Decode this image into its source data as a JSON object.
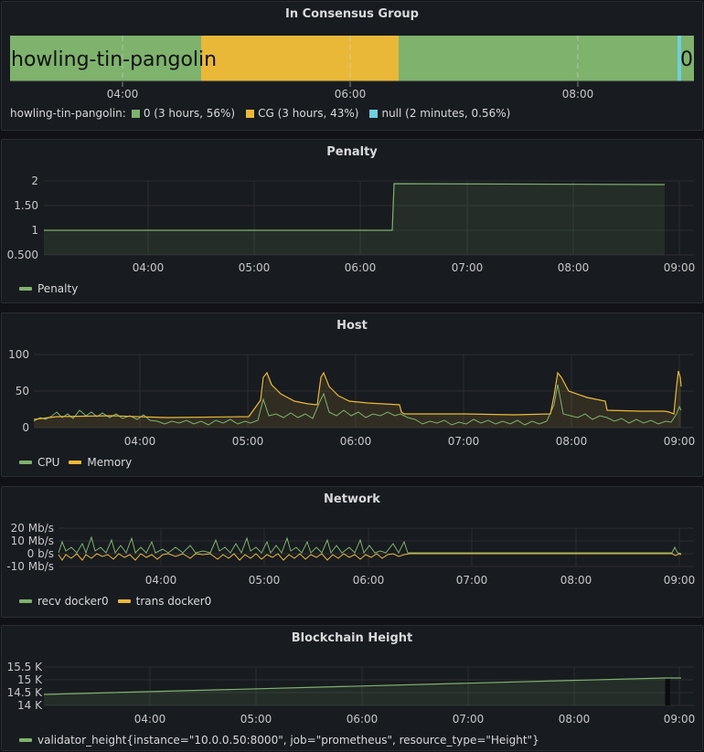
{
  "colors": {
    "green": "#7eb26d",
    "yellow": "#eab839",
    "cyan": "#6ed0e0",
    "grid": "#2b2e33",
    "bg": "#181b1f"
  },
  "consensus": {
    "title": "In Consensus Group",
    "left_label": "howling-tin-pangolin",
    "right_label": "0",
    "times": [
      "04:00",
      "06:00",
      "08:00"
    ],
    "legend_prefix": "howling-tin-pangolin:",
    "legend": [
      {
        "label": "0 (3 hours, 56%)",
        "color": "#7eb26d"
      },
      {
        "label": "CG (3 hours, 43%)",
        "color": "#eab839"
      },
      {
        "label": "null (2 minutes, 0.56%)",
        "color": "#6ed0e0"
      }
    ]
  },
  "penalty": {
    "title": "Penalty",
    "y_ticks": [
      "2",
      "1.50",
      "1",
      "0.500"
    ],
    "x_ticks": [
      "04:00",
      "05:00",
      "06:00",
      "07:00",
      "08:00",
      "09:00"
    ],
    "legend": [
      {
        "label": "Penalty",
        "color": "#7eb26d"
      }
    ]
  },
  "host": {
    "title": "Host",
    "y_ticks": [
      "100",
      "50",
      "0"
    ],
    "x_ticks": [
      "04:00",
      "05:00",
      "06:00",
      "07:00",
      "08:00",
      "09:00"
    ],
    "legend": [
      {
        "label": "CPU",
        "color": "#7eb26d"
      },
      {
        "label": "Memory",
        "color": "#eab839"
      }
    ]
  },
  "network": {
    "title": "Network",
    "y_ticks": [
      "20 Mb/s",
      "10 Mb/s",
      "0 b/s",
      "-10 Mb/s"
    ],
    "x_ticks": [
      "04:00",
      "05:00",
      "06:00",
      "07:00",
      "08:00",
      "09:00"
    ],
    "legend": [
      {
        "label": "recv docker0",
        "color": "#7eb26d"
      },
      {
        "label": "trans docker0",
        "color": "#eab839"
      }
    ]
  },
  "height": {
    "title": "Blockchain Height",
    "y_ticks": [
      "15.5 K",
      "15 K",
      "14.5 K",
      "14 K"
    ],
    "x_ticks": [
      "04:00",
      "05:00",
      "06:00",
      "07:00",
      "08:00",
      "09:00"
    ],
    "legend": [
      {
        "label": "validator_height{instance=\"10.0.0.50:8000\", job=\"prometheus\", resource_type=\"Height\"}",
        "color": "#7eb26d"
      }
    ]
  }
}
